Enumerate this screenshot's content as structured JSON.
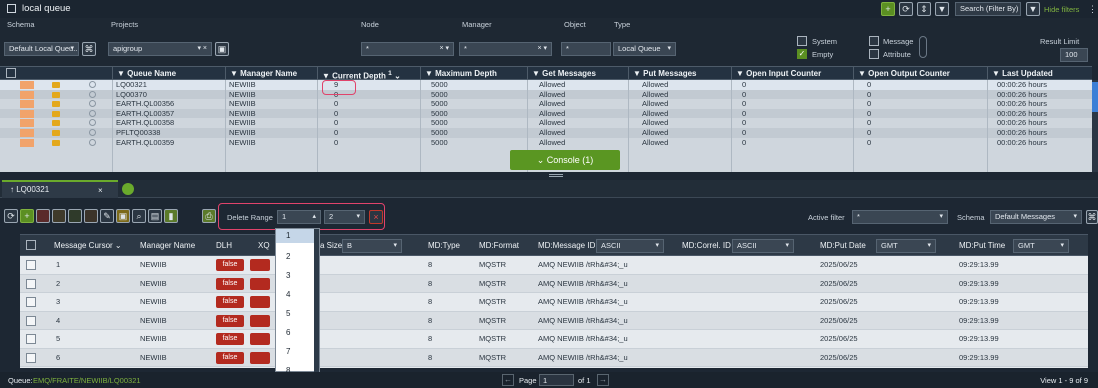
{
  "window": {
    "title": "local queue"
  },
  "filters": {
    "schema_label": "Schema",
    "schema_value": "Default Local Queu...",
    "projects_label": "Projects",
    "projects_value": "apigroup",
    "node_label": "Node",
    "node_value": "*",
    "manager_label": "Manager",
    "manager_value": "*",
    "object_label": "Object",
    "object_value": "*",
    "type_label": "Type",
    "type_value": "Local Queue",
    "system_label": "System",
    "empty_label": "Empty",
    "message_label": "Message",
    "attribute_label": "Attribute",
    "result_limit_label": "Result Limit",
    "result_limit_value": "100",
    "search_placeholder": "Search (Filter By)",
    "hide_filters": "Hide filters"
  },
  "queue_table": {
    "headers": [
      "Queue Name",
      "Manager Name",
      "Current Depth",
      "Maximum Depth",
      "Get Messages",
      "Put Messages",
      "Open Input Counter",
      "Open Output Counter",
      "Last Updated"
    ],
    "depth_sort": "1",
    "rows": [
      {
        "name": "LQ00321",
        "manager": "NEWIIB",
        "depth": "9",
        "max": "5000",
        "get": "Allowed",
        "put": "Allowed",
        "in": "0",
        "out": "0",
        "updated": "00:00:26 hours"
      },
      {
        "name": "LQ00370",
        "manager": "NEWIIB",
        "depth": "0",
        "max": "5000",
        "get": "Allowed",
        "put": "Allowed",
        "in": "0",
        "out": "0",
        "updated": "00:00:26 hours"
      },
      {
        "name": "EARTH.QL00356",
        "manager": "NEWIIB",
        "depth": "0",
        "max": "5000",
        "get": "Allowed",
        "put": "Allowed",
        "in": "0",
        "out": "0",
        "updated": "00:00:26 hours"
      },
      {
        "name": "EARTH.QL00357",
        "manager": "NEWIIB",
        "depth": "0",
        "max": "5000",
        "get": "Allowed",
        "put": "Allowed",
        "in": "0",
        "out": "0",
        "updated": "00:00:26 hours"
      },
      {
        "name": "EARTH.QL00358",
        "manager": "NEWIIB",
        "depth": "0",
        "max": "5000",
        "get": "Allowed",
        "put": "Allowed",
        "in": "0",
        "out": "0",
        "updated": "00:00:26 hours"
      },
      {
        "name": "PFLTQ00338",
        "manager": "NEWIIB",
        "depth": "0",
        "max": "5000",
        "get": "Allowed",
        "put": "Allowed",
        "in": "0",
        "out": "0",
        "updated": "00:00:26 hours"
      },
      {
        "name": "EARTH.QL00359",
        "manager": "NEWIIB",
        "depth": "0",
        "max": "5000",
        "get": "Allowed",
        "put": "Allowed",
        "in": "0",
        "out": "0",
        "updated": "00:00:26 hours"
      }
    ]
  },
  "console_button": "Console (1)",
  "tab": {
    "label": "LQ00321"
  },
  "toolbar": {
    "delete_range_label": "Delete Range",
    "range_from": "1",
    "range_to": "2",
    "active_filter_label": "Active filter",
    "active_filter_value": "*",
    "schema_label": "Schema",
    "schema_value": "Default Messages"
  },
  "message_table": {
    "headers": {
      "cursor": "Message Cursor",
      "manager": "Manager Name",
      "dlh": "DLH",
      "xq": "XQ",
      "data_size": "a Size",
      "data_size_enc": "B",
      "mdtype": "MD:Type",
      "mdformat": "MD:Format",
      "msgid": "MD:Message ID",
      "msgid_enc": "ASCII",
      "correl": "MD:Correl. ID",
      "correl_enc": "ASCII",
      "putdate": "MD:Put Date",
      "putdate_tz": "GMT",
      "puttime": "MD:Put Time",
      "puttime_tz": "GMT"
    },
    "rows": [
      {
        "cursor": "1",
        "manager": "NEWIIB",
        "dlh": "false",
        "type": "8",
        "format": "MQSTR",
        "msgid": "AMQ NEWIIB /tRh&#34;_u",
        "date": "2025/06/25",
        "time": "09:29:13.99"
      },
      {
        "cursor": "2",
        "manager": "NEWIIB",
        "dlh": "false",
        "type": "8",
        "format": "MQSTR",
        "msgid": "AMQ NEWIIB /tRh&#34;_u",
        "date": "2025/06/25",
        "time": "09:29:13.99"
      },
      {
        "cursor": "3",
        "manager": "NEWIIB",
        "dlh": "false",
        "type": "8",
        "format": "MQSTR",
        "msgid": "AMQ NEWIIB /tRh&#34;_u",
        "date": "2025/06/25",
        "time": "09:29:13.99"
      },
      {
        "cursor": "4",
        "manager": "NEWIIB",
        "dlh": "false",
        "type": "8",
        "format": "MQSTR",
        "msgid": "AMQ NEWIIB /tRh&#34;_u",
        "date": "2025/06/25",
        "time": "09:29:13.99"
      },
      {
        "cursor": "5",
        "manager": "NEWIIB",
        "dlh": "false",
        "type": "8",
        "format": "MQSTR",
        "msgid": "AMQ NEWIIB /tRh&#34;_u",
        "date": "2025/06/25",
        "time": "09:29:13.99"
      },
      {
        "cursor": "6",
        "manager": "NEWIIB",
        "dlh": "false",
        "type": "8",
        "format": "MQSTR",
        "msgid": "AMQ NEWIIB /tRh&#34;_u",
        "date": "2025/06/25",
        "time": "09:29:13.99"
      }
    ]
  },
  "dropdown": {
    "options": [
      "1",
      "2",
      "3",
      "4",
      "5",
      "6",
      "7",
      "8"
    ]
  },
  "footer": {
    "queue_label": "Queue:",
    "queue_path": "EMQ/FRAITE/NEWIIB/LQ00321",
    "page_label": "Page",
    "page_value": "1",
    "page_of": "of 1",
    "view_count": "View 1 - 9 of 9"
  },
  "icons": [
    "queue-icon",
    "folder-icon",
    "clock-icon",
    "filter-icon",
    "refresh-icon",
    "close-icon",
    "arrow-icon",
    "search-icon"
  ]
}
